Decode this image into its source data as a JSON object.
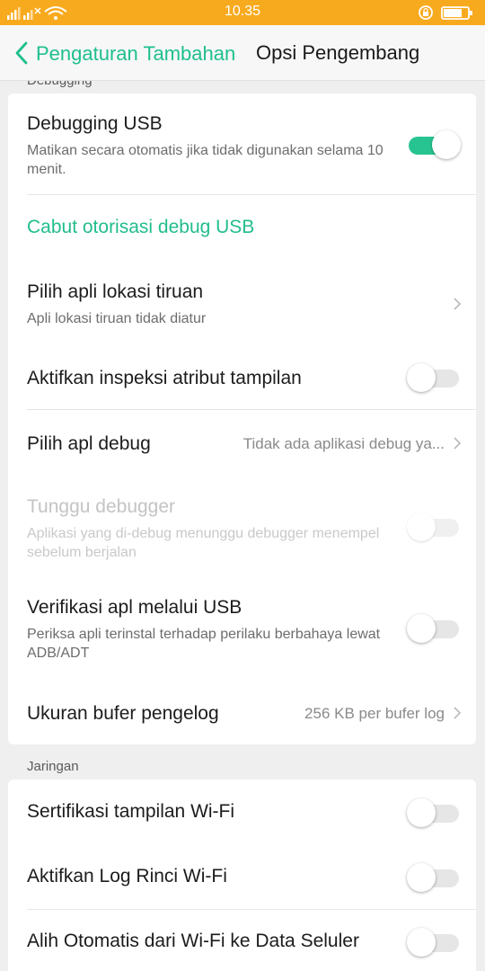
{
  "status_bar": {
    "time": "10.35",
    "icons": [
      "signal-icon",
      "signal-icon",
      "wifi-icon",
      "rotation-lock-icon",
      "battery-icon"
    ]
  },
  "header": {
    "back_label": "Pengaturan Tambahan",
    "title": "Opsi Pengembang"
  },
  "sections": {
    "debugging": "Debugging",
    "network": "Jaringan"
  },
  "debug_items": {
    "usb_debugging": {
      "title": "Debugging USB",
      "subtitle": "Matikan secara otomatis jika tidak digunakan selama 10 menit.",
      "toggle": "on"
    },
    "revoke": {
      "title": "Cabut otorisasi debug USB"
    },
    "mock_location": {
      "title": "Pilih apli lokasi tiruan",
      "subtitle": "Apli lokasi tiruan tidak diatur"
    },
    "view_attr": {
      "title": "Aktifkan inspeksi atribut tampilan",
      "toggle": "off"
    },
    "debug_app": {
      "title": "Pilih apl debug",
      "value": "Tidak ada aplikasi debug ya..."
    },
    "wait_debugger": {
      "title": "Tunggu debugger",
      "subtitle": "Aplikasi yang di-debug menunggu debugger menempel sebelum berjalan",
      "toggle": "off",
      "enabled": false
    },
    "verify_usb": {
      "title": "Verifikasi apl melalui USB",
      "subtitle": "Periksa apli terinstal terhadap perilaku berbahaya lewat ADB/ADT",
      "toggle": "off"
    },
    "logger_buffer": {
      "title": "Ukuran bufer pengelog",
      "value": "256 KB per bufer log"
    }
  },
  "network_items": {
    "wifi_cert": {
      "title": "Sertifikasi tampilan Wi-Fi",
      "toggle": "off"
    },
    "wifi_verbose": {
      "title": "Aktifkan Log Rinci Wi-Fi",
      "toggle": "off"
    },
    "wifi_to_cell": {
      "title": "Alih Otomatis dari Wi-Fi ke Data Seluler",
      "toggle": "off"
    }
  },
  "colors": {
    "status_bar": "#f8aa1e",
    "accent": "#1fbf8e",
    "toggle_on": "#27c491"
  }
}
